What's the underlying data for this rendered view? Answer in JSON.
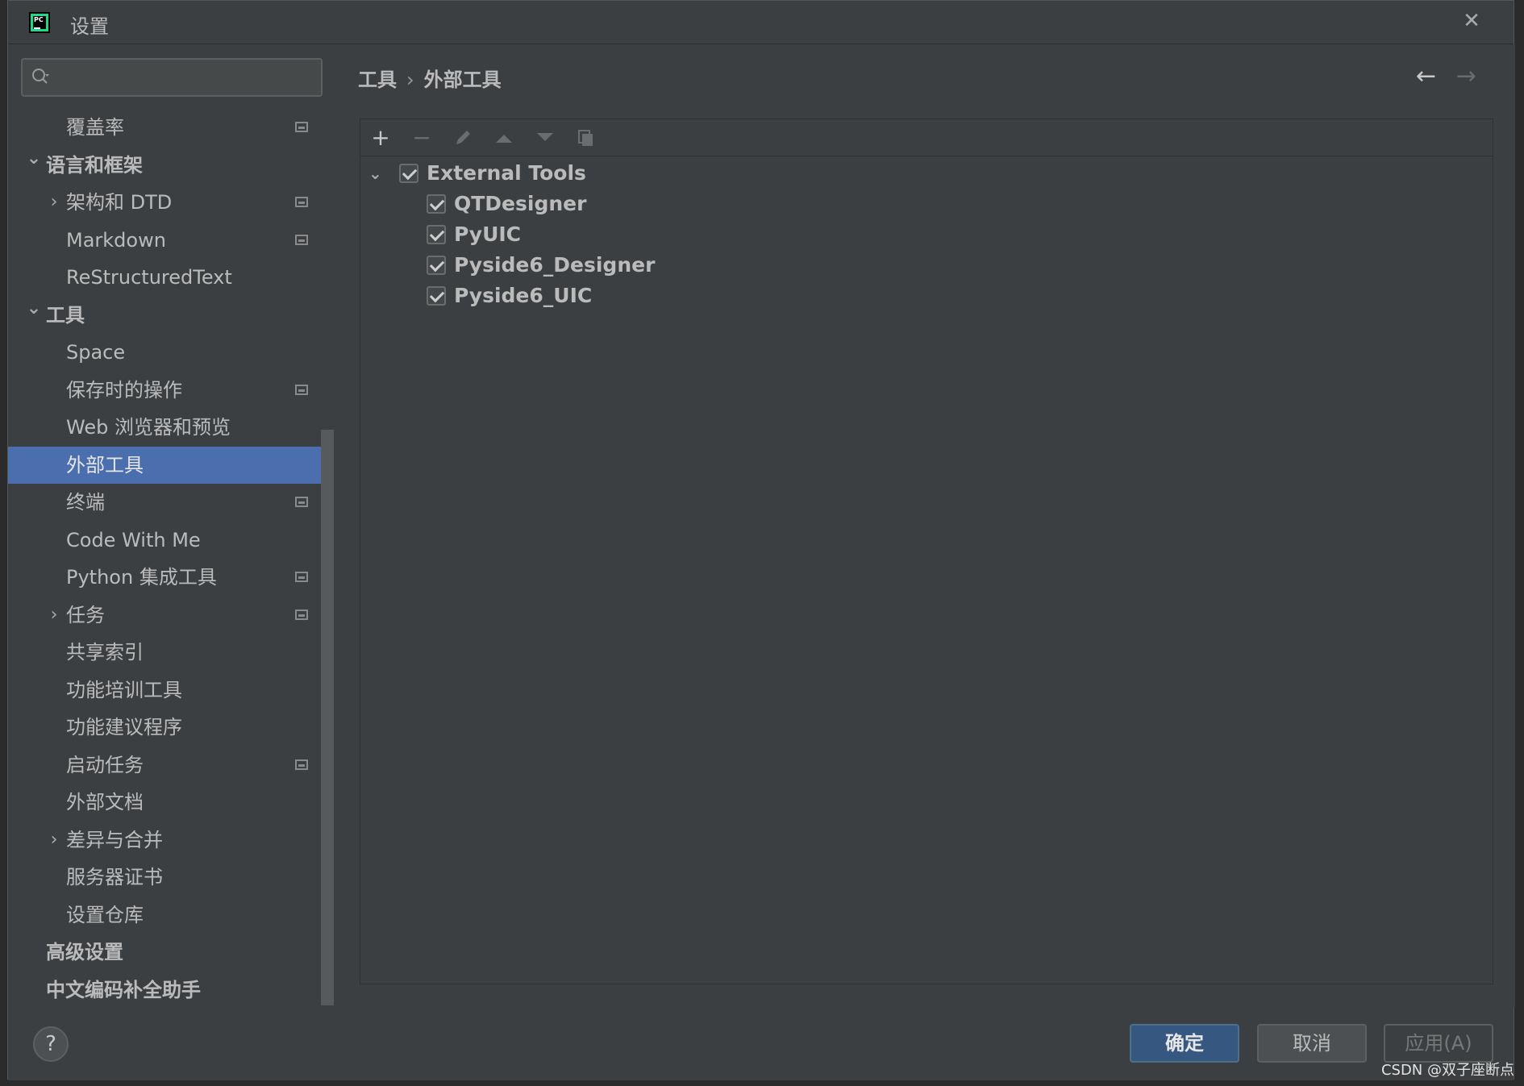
{
  "window": {
    "title": "设置"
  },
  "search": {
    "placeholder": ""
  },
  "sidebar": {
    "items": [
      {
        "label": "覆盖率",
        "indent": 2,
        "bold": false,
        "chevron": "",
        "proj": true
      },
      {
        "label": "语言和框架",
        "indent": 1,
        "bold": true,
        "chevron": "down",
        "proj": false
      },
      {
        "label": "架构和 DTD",
        "indent": 2,
        "bold": false,
        "chevron": "right",
        "proj": true
      },
      {
        "label": "Markdown",
        "indent": 2,
        "bold": false,
        "chevron": "",
        "proj": true
      },
      {
        "label": "ReStructuredText",
        "indent": 2,
        "bold": false,
        "chevron": "",
        "proj": false
      },
      {
        "label": "工具",
        "indent": 1,
        "bold": true,
        "chevron": "down",
        "proj": false
      },
      {
        "label": "Space",
        "indent": 2,
        "bold": false,
        "chevron": "",
        "proj": false
      },
      {
        "label": "保存时的操作",
        "indent": 2,
        "bold": false,
        "chevron": "",
        "proj": true
      },
      {
        "label": "Web 浏览器和预览",
        "indent": 2,
        "bold": false,
        "chevron": "",
        "proj": false
      },
      {
        "label": "外部工具",
        "indent": 2,
        "bold": false,
        "chevron": "",
        "proj": false,
        "selected": true
      },
      {
        "label": "终端",
        "indent": 2,
        "bold": false,
        "chevron": "",
        "proj": true
      },
      {
        "label": "Code With Me",
        "indent": 2,
        "bold": false,
        "chevron": "",
        "proj": false
      },
      {
        "label": "Python 集成工具",
        "indent": 2,
        "bold": false,
        "chevron": "",
        "proj": true
      },
      {
        "label": "任务",
        "indent": 2,
        "bold": false,
        "chevron": "right",
        "proj": true
      },
      {
        "label": "共享索引",
        "indent": 2,
        "bold": false,
        "chevron": "",
        "proj": false
      },
      {
        "label": "功能培训工具",
        "indent": 2,
        "bold": false,
        "chevron": "",
        "proj": false
      },
      {
        "label": "功能建议程序",
        "indent": 2,
        "bold": false,
        "chevron": "",
        "proj": false
      },
      {
        "label": "启动任务",
        "indent": 2,
        "bold": false,
        "chevron": "",
        "proj": true
      },
      {
        "label": "外部文档",
        "indent": 2,
        "bold": false,
        "chevron": "",
        "proj": false
      },
      {
        "label": "差异与合并",
        "indent": 2,
        "bold": false,
        "chevron": "right",
        "proj": false
      },
      {
        "label": "服务器证书",
        "indent": 2,
        "bold": false,
        "chevron": "",
        "proj": false
      },
      {
        "label": "设置仓库",
        "indent": 2,
        "bold": false,
        "chevron": "",
        "proj": false
      },
      {
        "label": "高级设置",
        "indent": 1,
        "bold": true,
        "chevron": "",
        "proj": false
      },
      {
        "label": "中文编码补全助手",
        "indent": 1,
        "bold": true,
        "chevron": "",
        "proj": false
      }
    ]
  },
  "breadcrumb": {
    "parent": "工具",
    "separator": "›",
    "current": "外部工具"
  },
  "toolbar": [
    "add-icon",
    "remove-icon",
    "edit-icon",
    "move-up-icon",
    "move-down-icon",
    "copy-icon"
  ],
  "tools": {
    "group": {
      "label": "External Tools",
      "checked": true,
      "expanded": true
    },
    "items": [
      {
        "label": "QTDesigner",
        "checked": true
      },
      {
        "label": "PyUIC",
        "checked": true
      },
      {
        "label": "Pyside6_Designer",
        "checked": true
      },
      {
        "label": "Pyside6_UIC",
        "checked": true
      }
    ]
  },
  "footer": {
    "help": "?",
    "ok": "确定",
    "cancel": "取消",
    "apply": "应用(A)"
  },
  "watermark": "CSDN @双子座断点",
  "colors": {
    "background": "#3c3f41",
    "selection": "#4b6eaf",
    "primary_button": "#365880",
    "text": "#bbbbbb"
  }
}
